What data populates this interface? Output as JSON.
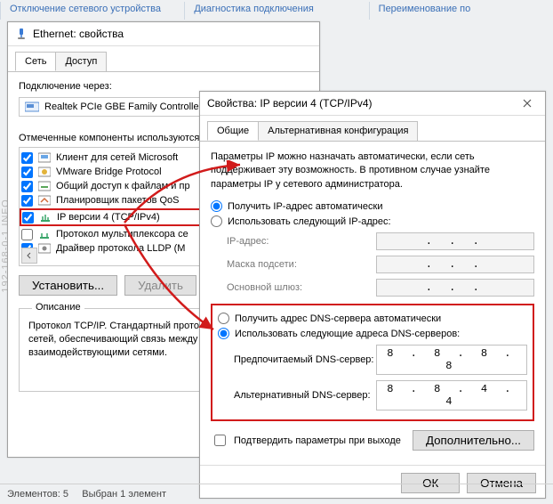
{
  "ribbon": {
    "item1": "Отключение сетевого устройства",
    "item2": "Диагностика подключения",
    "item3": "Переименование по"
  },
  "ethWindow": {
    "title": "Ethernet: свойства",
    "tabs": {
      "network": "Сеть",
      "access": "Доступ"
    },
    "connectVia": "Подключение через:",
    "adapter": "Realtek PCIe GBE Family Controller",
    "componentsLabel": "Отмеченные компоненты используются",
    "items": {
      "c0": "Клиент для сетей Microsoft",
      "c1": "VMware Bridge Protocol",
      "c2": "Общий доступ к файлам и пр",
      "c3": "Планировщик пакетов QoS",
      "c4": "IP версии 4 (TCP/IPv4)",
      "c5": "Протокол мультиплексора се",
      "c6": "Драйвер протокола LLDP (М"
    },
    "install": "Установить...",
    "uninstall": "Удалить",
    "descTitle": "Описание",
    "desc": "Протокол TCP/IP. Стандартный протокол глобальных сетей, обеспечивающий связь между различными взаимодействующими сетями."
  },
  "ipWindow": {
    "title": "Свойства: IP версии 4 (TCP/IPv4)",
    "tabs": {
      "general": "Общие",
      "alt": "Альтернативная конфигурация"
    },
    "intro": "Параметры IP можно назначать автоматически, если сеть поддерживает эту возможность. В противном случае узнайте параметры IP у сетевого администратора.",
    "ipAuto": "Получить IP-адрес автоматически",
    "ipManual": "Использовать следующий IP-адрес:",
    "ipAddr": "IP-адрес:",
    "mask": "Маска подсети:",
    "gateway": "Основной шлюз:",
    "dnsAuto": "Получить адрес DNS-сервера автоматически",
    "dnsManual": "Использовать следующие адреса DNS-серверов:",
    "dnsPref": "Предпочитаемый DNS-сервер:",
    "dnsAlt": "Альтернативный DNS-сервер:",
    "dnsPrefVal": "8 . 8 . 8 . 8",
    "dnsAltVal": "8 . 8 . 4 . 4",
    "validate": "Подтвердить параметры при выходе",
    "advanced": "Дополнительно...",
    "ok": "ОК",
    "cancel": "Отмена"
  },
  "status": {
    "elements": "Элементов: 5",
    "selected": "Выбран 1 элемент"
  },
  "watermark": "192-168-0-1.INFO",
  "blank": ". . ."
}
